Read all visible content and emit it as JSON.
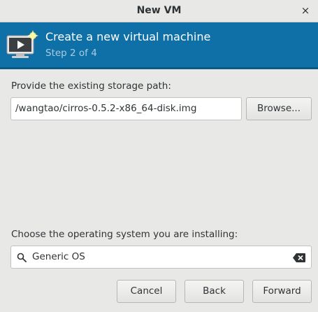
{
  "window": {
    "title": "New VM",
    "close_glyph": "×"
  },
  "header": {
    "title": "Create a new virtual machine",
    "step": "Step 2 of 4",
    "icon": "vm-monitor-icon"
  },
  "storage": {
    "label": "Provide the existing storage path:",
    "path_value": "/wangtao/cirros-0.5.2-x86_64-disk.img",
    "browse_label": "Browse..."
  },
  "os": {
    "label": "Choose the operating system you are installing:",
    "search_value": "Generic OS",
    "search_icon": "search-icon",
    "clear_icon": "clear-icon"
  },
  "buttons": {
    "cancel": "Cancel",
    "back": "Back",
    "forward": "Forward"
  },
  "colors": {
    "header_bg": "#0e70a6",
    "step_text": "#a9cce3",
    "window_bg": "#e8e8e7"
  }
}
